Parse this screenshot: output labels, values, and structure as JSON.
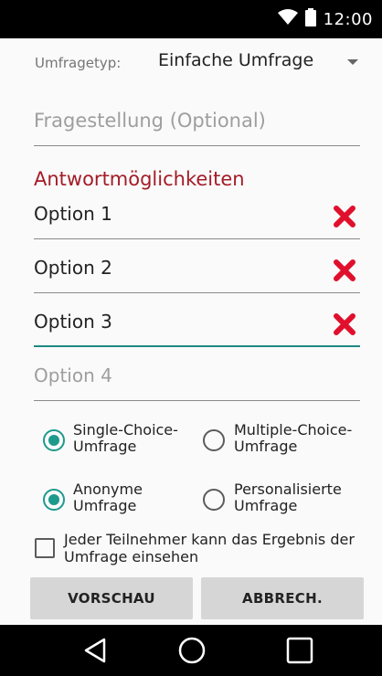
{
  "status_bar": {
    "time": "12:00",
    "icons": [
      "wifi-icon",
      "battery-icon"
    ]
  },
  "form": {
    "survey_type_label": "Umfragetyp:",
    "survey_type_value": "Einfache Umfrage",
    "question_placeholder": "Fragestellung (Optional)",
    "answers_title": "Antwortmöglichkeiten",
    "options": [
      {
        "text": "Option 1",
        "placeholder": false,
        "removable": true
      },
      {
        "text": "Option 2",
        "placeholder": false,
        "removable": true
      },
      {
        "text": "Option 3",
        "placeholder": false,
        "removable": true,
        "focused": true
      },
      {
        "text": "Option 4",
        "placeholder": true,
        "removable": false
      }
    ],
    "choice_single": "Single-Choice-\nUmfrage",
    "choice_multiple": "Multiple-Choice-\nUmfrage",
    "choice_single_checked": true,
    "privacy_anonymous": "Anonyme\nUmfrage",
    "privacy_personal": "Personalisierte\nUmfrage",
    "privacy_anonymous_checked": true,
    "results_visible_label": "Jeder Teilnehmer kann das Ergebnis der Umfrage einsehen",
    "results_visible_checked": false
  },
  "buttons": {
    "preview": "VORSCHAU",
    "cancel": "ABBRECH."
  },
  "navigation": [
    "back-icon",
    "home-icon",
    "recents-icon"
  ],
  "colors": {
    "accent": "#1e9a8c",
    "section_title": "#a31c27",
    "remove": "#e0102d",
    "button_bg": "#d6d6d6"
  }
}
